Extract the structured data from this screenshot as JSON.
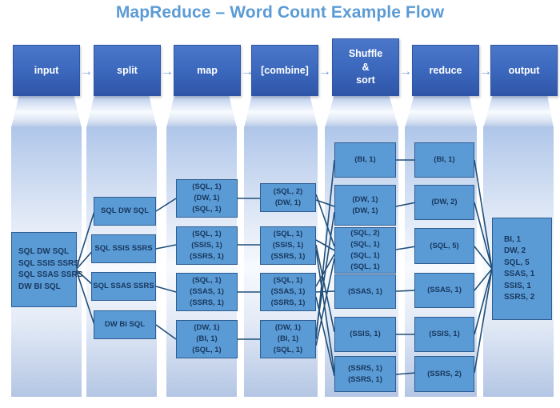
{
  "title": "MapReduce – Word Count Example Flow",
  "accent_color": "#5B9BD5",
  "header_color": "#3C69BE",
  "stages": [
    {
      "id": "input",
      "label": "input"
    },
    {
      "id": "split",
      "label": "split"
    },
    {
      "id": "map",
      "label": "map"
    },
    {
      "id": "combine",
      "label": "[combine]"
    },
    {
      "id": "shuffle",
      "label": "Shuffle\n&\nsort"
    },
    {
      "id": "reduce",
      "label": "reduce"
    },
    {
      "id": "output",
      "label": "output"
    }
  ],
  "arrow_glyph": "→",
  "input": {
    "lines": [
      "SQL DW SQL",
      "SQL SSIS SSRS",
      "SQL SSAS SSRS",
      "DW BI SQL"
    ]
  },
  "split": {
    "boxes": [
      {
        "lines": [
          "SQL DW SQL"
        ]
      },
      {
        "lines": [
          "SQL SSIS SSRS"
        ]
      },
      {
        "lines": [
          "SQL SSAS SSRS"
        ]
      },
      {
        "lines": [
          "DW BI SQL"
        ]
      }
    ]
  },
  "map": {
    "boxes": [
      {
        "lines": [
          "(SQL, 1)",
          "(DW, 1)",
          "(SQL, 1)"
        ]
      },
      {
        "lines": [
          "(SQL, 1)",
          "(SSIS, 1)",
          "(SSRS, 1)"
        ]
      },
      {
        "lines": [
          "(SQL, 1)",
          "(SSAS, 1)",
          "(SSRS, 1)"
        ]
      },
      {
        "lines": [
          "(DW, 1)",
          "(BI, 1)",
          "(SQL, 1)"
        ]
      }
    ]
  },
  "combine": {
    "boxes": [
      {
        "lines": [
          "(SQL, 2)",
          "(DW, 1)"
        ]
      },
      {
        "lines": [
          "(SQL, 1)",
          "(SSIS, 1)",
          "(SSRS, 1)"
        ]
      },
      {
        "lines": [
          "(SQL, 1)",
          "(SSAS, 1)",
          "(SSRS, 1)"
        ]
      },
      {
        "lines": [
          "(DW, 1)",
          "(BI, 1)",
          "(SQL, 1)"
        ]
      }
    ]
  },
  "shuffle": {
    "boxes": [
      {
        "lines": [
          "(BI, 1)"
        ]
      },
      {
        "lines": [
          "(DW, 1)",
          "(DW, 1)"
        ]
      },
      {
        "lines": [
          "(SQL, 2)",
          "(SQL, 1)",
          "(SQL, 1)",
          "(SQL, 1)"
        ]
      },
      {
        "lines": [
          "(SSAS, 1)"
        ]
      },
      {
        "lines": [
          "(SSIS, 1)"
        ]
      },
      {
        "lines": [
          "(SSRS, 1)",
          "(SSRS, 1)"
        ]
      }
    ]
  },
  "reduce": {
    "boxes": [
      {
        "lines": [
          "(BI, 1)"
        ]
      },
      {
        "lines": [
          "(DW, 2)"
        ]
      },
      {
        "lines": [
          "(SQL, 5)"
        ]
      },
      {
        "lines": [
          "(SSAS, 1)"
        ]
      },
      {
        "lines": [
          "(SSIS, 1)"
        ]
      },
      {
        "lines": [
          "(SSRS, 2)"
        ]
      }
    ]
  },
  "output": {
    "lines": [
      "BI, 1",
      "DW, 2",
      "SQL, 5",
      "SSAS, 1",
      "SSIS, 1",
      "SSRS, 2"
    ]
  }
}
